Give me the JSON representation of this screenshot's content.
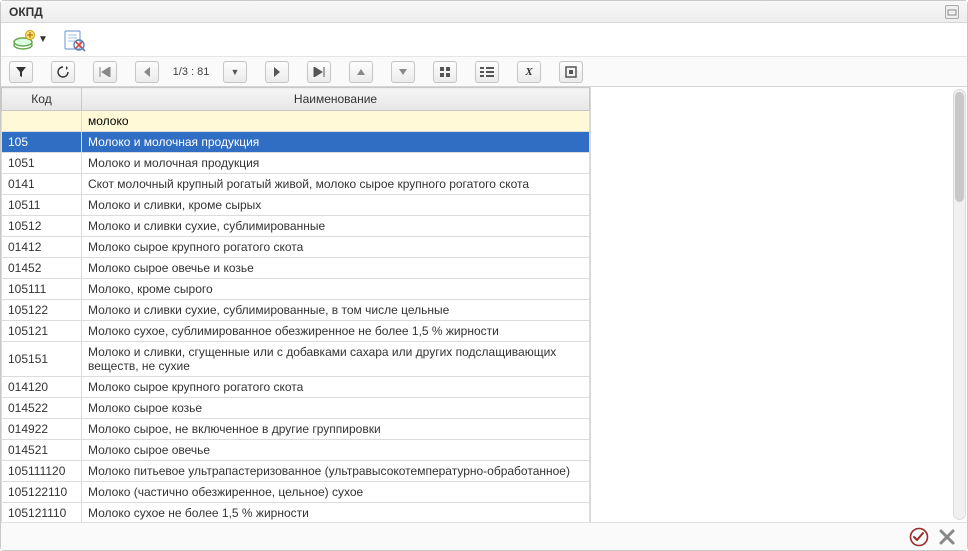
{
  "window": {
    "title": "ОКПД"
  },
  "pager": {
    "label": "1/3 : 81"
  },
  "grid": {
    "headers": {
      "code": "Код",
      "name": "Наименование"
    },
    "filter": {
      "code": "",
      "name": "молоко"
    },
    "rows": [
      {
        "code": "105",
        "name": "Молоко и молочная продукция",
        "selected": true
      },
      {
        "code": "1051",
        "name": "Молоко и молочная продукция"
      },
      {
        "code": "0141",
        "name": "Скот молочный крупный рогатый живой, молоко сырое крупного рогатого скота"
      },
      {
        "code": "10511",
        "name": "Молоко и сливки, кроме сырых"
      },
      {
        "code": "10512",
        "name": "Молоко и сливки сухие, сублимированные"
      },
      {
        "code": "01412",
        "name": "Молоко сырое крупного рогатого скота"
      },
      {
        "code": "01452",
        "name": "Молоко сырое овечье и козье"
      },
      {
        "code": "105111",
        "name": "Молоко, кроме сырого"
      },
      {
        "code": "105122",
        "name": "Молоко и сливки сухие, сублимированные, в том числе цельные"
      },
      {
        "code": "105121",
        "name": "Молоко сухое, сублимированное обезжиренное не более 1,5 % жирности"
      },
      {
        "code": "105151",
        "name": "Молоко и сливки, сгущенные или с добавками сахара или других подслащивающих веществ, не сухие"
      },
      {
        "code": "014120",
        "name": "Молоко сырое крупного рогатого скота"
      },
      {
        "code": "014522",
        "name": "Молоко сырое козье"
      },
      {
        "code": "014922",
        "name": "Молоко сырое, не включенное в другие группировки"
      },
      {
        "code": "014521",
        "name": "Молоко сырое овечье"
      },
      {
        "code": "105111120",
        "name": "Молоко питьевое ультрапастеризованное (ультравысокотемпературно-обработанное)"
      },
      {
        "code": "105122110",
        "name": "Молоко (частично обезжиренное, цельное) сухое"
      },
      {
        "code": "105121110",
        "name": "Молоко сухое не более 1,5 % жирности"
      }
    ]
  }
}
